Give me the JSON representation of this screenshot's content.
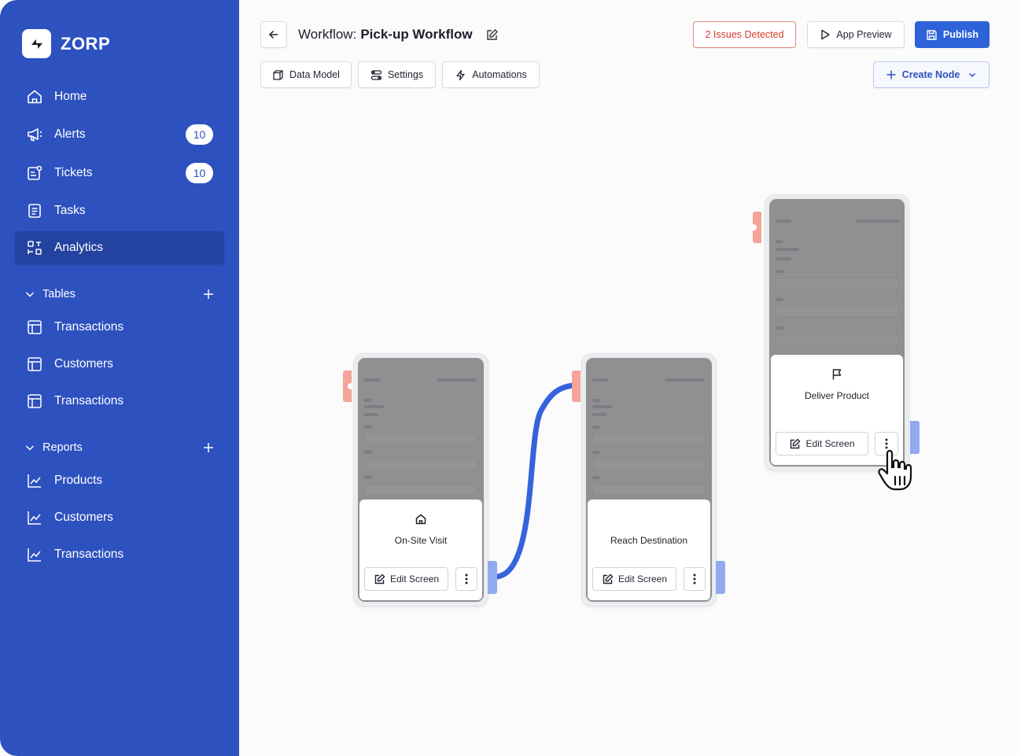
{
  "brand": {
    "name": "ZORP"
  },
  "sidebar": {
    "nav": [
      {
        "label": "Home",
        "icon": "home-icon"
      },
      {
        "label": "Alerts",
        "icon": "megaphone-icon",
        "badge": "10"
      },
      {
        "label": "Tickets",
        "icon": "ticket-icon",
        "badge": "10"
      },
      {
        "label": "Tasks",
        "icon": "tasks-icon"
      },
      {
        "label": "Analytics",
        "icon": "analytics-icon",
        "active": true
      }
    ],
    "tables_section": {
      "label": "Tables",
      "items": [
        {
          "label": "Transactions",
          "icon": "table-icon"
        },
        {
          "label": "Customers",
          "icon": "table-icon"
        },
        {
          "label": "Transactions",
          "icon": "table-icon"
        }
      ]
    },
    "reports_section": {
      "label": "Reports",
      "items": [
        {
          "label": "Products",
          "icon": "chart-line-icon"
        },
        {
          "label": "Customers",
          "icon": "chart-line-icon"
        },
        {
          "label": "Transactions",
          "icon": "chart-line-icon"
        }
      ]
    }
  },
  "header": {
    "title_prefix": "Workflow:",
    "title_name": "Pick-up Workflow",
    "issues_label": "2 Issues Detected",
    "preview_label": "App Preview",
    "publish_label": "Publish",
    "tabs": [
      {
        "label": "Data Model",
        "icon": "cube-icon"
      },
      {
        "label": "Settings",
        "icon": "settings-icon"
      },
      {
        "label": "Automations",
        "icon": "bolt-icon"
      }
    ],
    "create_label": "Create Node"
  },
  "nodes": [
    {
      "title": "On-Site Visit",
      "icon": "home-icon",
      "edit_label": "Edit Screen"
    },
    {
      "title": "Reach Destination",
      "icon": "",
      "edit_label": "Edit Screen"
    },
    {
      "title": "Deliver Product",
      "icon": "flag-icon",
      "edit_label": "Edit Screen"
    }
  ],
  "colors": {
    "sidebar": "#2d51bf",
    "primary": "#2d62d8",
    "danger": "#d63b2c",
    "port_in": "#f4a49b",
    "port_out": "#91a9ef",
    "connector": "#3563dc"
  }
}
